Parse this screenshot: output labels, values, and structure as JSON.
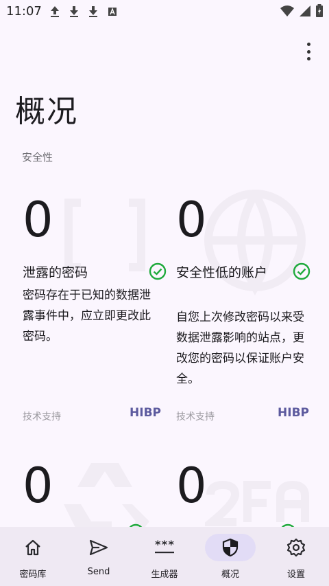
{
  "status_bar": {
    "time": "11:07",
    "left_icons": [
      "upload-icon",
      "download-icon",
      "download-icon",
      "keyboard-a-icon"
    ],
    "right_icons": [
      "wifi-icon",
      "signal-icon",
      "battery-icon"
    ]
  },
  "page": {
    "title": "概况"
  },
  "section": {
    "security_header": "安全性"
  },
  "cards": [
    {
      "count": "0",
      "title": "泄露的密码",
      "description": "密码存在于已知的数据泄露事件中，应立即更改此密码。",
      "provider_label": "技术支持",
      "provider_link": "HIBP",
      "status_icon": "check-circle-icon",
      "background_icon": "brackets-icon"
    },
    {
      "count": "0",
      "title": "安全性低的账户",
      "description": "自您上次修改密码以来受数据泄露影响的站点，更改您的密码以保证账户安全。",
      "provider_label": "技术支持",
      "provider_link": "HIBP",
      "status_icon": "check-circle-icon",
      "background_icon": "globe-icon"
    },
    {
      "count": "0",
      "background_icon": "recycle-icon",
      "status_icon": "check-circle-icon"
    },
    {
      "count": "0",
      "background_icon": "2fa-icon",
      "status_icon": "check-circle-icon"
    }
  ],
  "bottom_nav": {
    "items": [
      {
        "label": "密码库",
        "icon": "home-icon"
      },
      {
        "label": "Send",
        "icon": "send-icon"
      },
      {
        "label": "生成器",
        "icon": "password-generator-icon"
      },
      {
        "label": "概况",
        "icon": "shield-icon",
        "active": true
      },
      {
        "label": "设置",
        "icon": "gear-icon"
      }
    ]
  },
  "colors": {
    "background": "#fbf6fe",
    "nav_background": "#efe9f3",
    "nav_active_pill": "#e2dcf6",
    "check_green": "#1faa3c",
    "link_purple": "#5c5a9e"
  }
}
